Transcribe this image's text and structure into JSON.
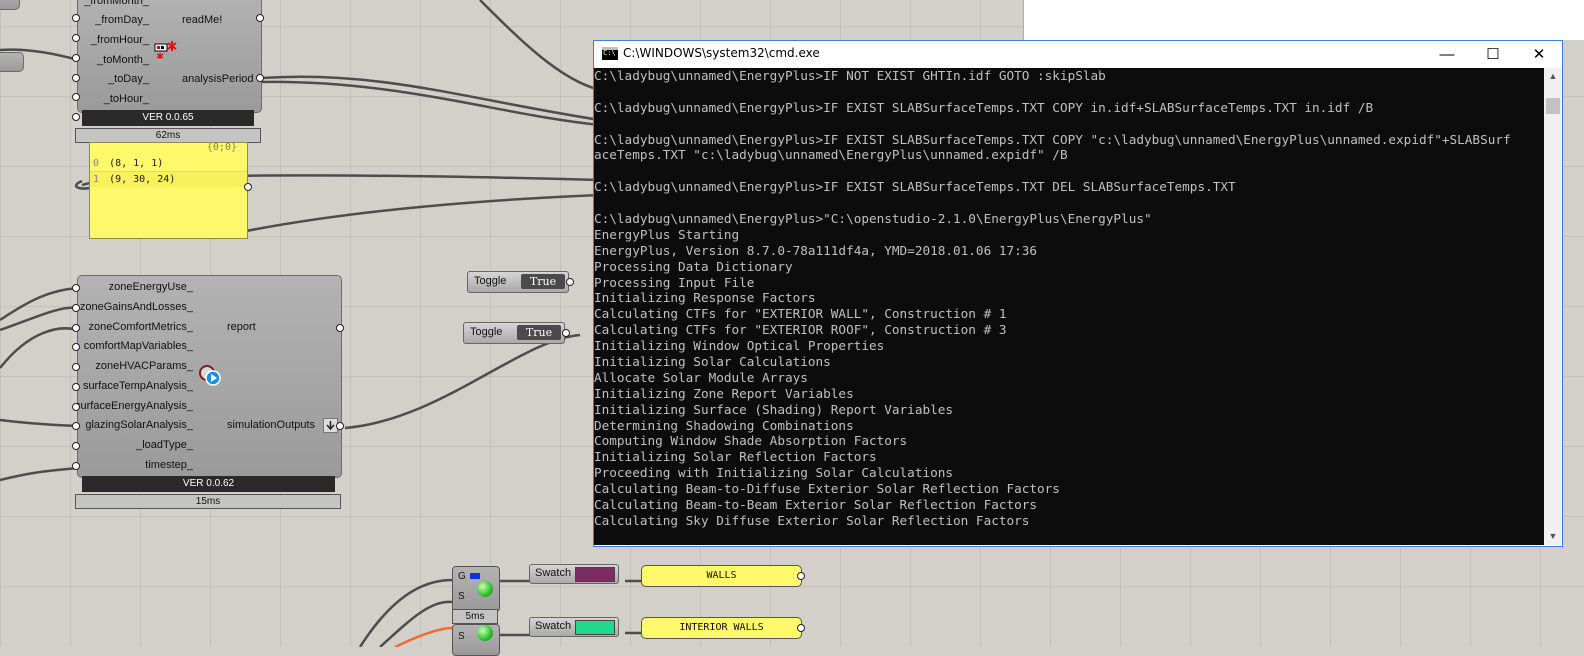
{
  "canvas": {
    "background_color": "#d3d0c9",
    "comp_top": {
      "inputs": [
        "_fromMonth_",
        "_fromDay_",
        "_fromHour_",
        "_toMonth_",
        "_toDay_",
        "_toHour_"
      ],
      "outputs": [
        "readMe!",
        "analysisPeriod"
      ],
      "version": "VER 0.0.65",
      "timer": "62ms",
      "icon_name": "analysis-period-icon"
    },
    "panel": {
      "header": "{0;0}",
      "rows": [
        {
          "index": "0",
          "value": "(8, 1, 1)"
        },
        {
          "index": "1",
          "value": "(9, 30, 24)"
        }
      ],
      "color": "#fff96b"
    },
    "comp_main": {
      "inputs": [
        "zoneEnergyUse_",
        "zoneGainsAndLosses_",
        "zoneComfortMetrics_",
        "comfortMapVariables_",
        "zoneHVACParams_",
        "surfaceTempAnalysis_",
        "surfaceEnergyAnalysis_",
        "glazingSolarAnalysis_",
        "_loadType_",
        "timestep_"
      ],
      "outputs": [
        "report",
        "simulationOutputs"
      ],
      "version": "VER 0.0.62",
      "timer": "15ms",
      "icon_name": "simulation-output-icon"
    },
    "toggles": [
      {
        "label": "Toggle",
        "value": "True"
      },
      {
        "label": "Toggle",
        "value": "True"
      }
    ],
    "swatches": [
      {
        "label": "Swatch",
        "color": "#7b2d5f"
      },
      {
        "label": "Swatch",
        "color": "#22d88a"
      }
    ],
    "labels": [
      "WALLS",
      "INTERIOR WALLS"
    ],
    "small_comp": {
      "ports": [
        "G",
        "S",
        "S"
      ],
      "timer": "5ms"
    }
  },
  "cmd": {
    "title": "C:\\WINDOWS\\system32\\cmd.exe",
    "minimize": "—",
    "maximize": "☐",
    "close": "✕",
    "scroll_up": "▲",
    "scroll_down": "▼",
    "lines": [
      "C:\\ladybug\\unnamed\\EnergyPlus>IF NOT EXIST GHTIn.idf GOTO :skipSlab",
      "",
      "C:\\ladybug\\unnamed\\EnergyPlus>IF EXIST SLABSurfaceTemps.TXT COPY in.idf+SLABSurfaceTemps.TXT in.idf /B",
      "",
      "C:\\ladybug\\unnamed\\EnergyPlus>IF EXIST SLABSurfaceTemps.TXT COPY \"c:\\ladybug\\unnamed\\EnergyPlus\\unnamed.expidf\"+SLABSurf",
      "aceTemps.TXT \"c:\\ladybug\\unnamed\\EnergyPlus\\unnamed.expidf\" /B",
      "",
      "C:\\ladybug\\unnamed\\EnergyPlus>IF EXIST SLABSurfaceTemps.TXT DEL SLABSurfaceTemps.TXT",
      "",
      "C:\\ladybug\\unnamed\\EnergyPlus>\"C:\\openstudio-2.1.0\\EnergyPlus\\EnergyPlus\"",
      "EnergyPlus Starting",
      "EnergyPlus, Version 8.7.0-78a111df4a, YMD=2018.01.06 17:36",
      "Processing Data Dictionary",
      "Processing Input File",
      "Initializing Response Factors",
      "Calculating CTFs for \"EXTERIOR WALL\", Construction # 1",
      "Calculating CTFs for \"EXTERIOR ROOF\", Construction # 3",
      "Initializing Window Optical Properties",
      "Initializing Solar Calculations",
      "Allocate Solar Module Arrays",
      "Initializing Zone Report Variables",
      "Initializing Surface (Shading) Report Variables",
      "Determining Shadowing Combinations",
      "Computing Window Shade Absorption Factors",
      "Initializing Solar Reflection Factors",
      "Proceeding with Initializing Solar Calculations",
      "Calculating Beam-to-Diffuse Exterior Solar Reflection Factors",
      "Calculating Beam-to-Beam Exterior Solar Reflection Factors",
      "Calculating Sky Diffuse Exterior Solar Reflection Factors"
    ]
  }
}
